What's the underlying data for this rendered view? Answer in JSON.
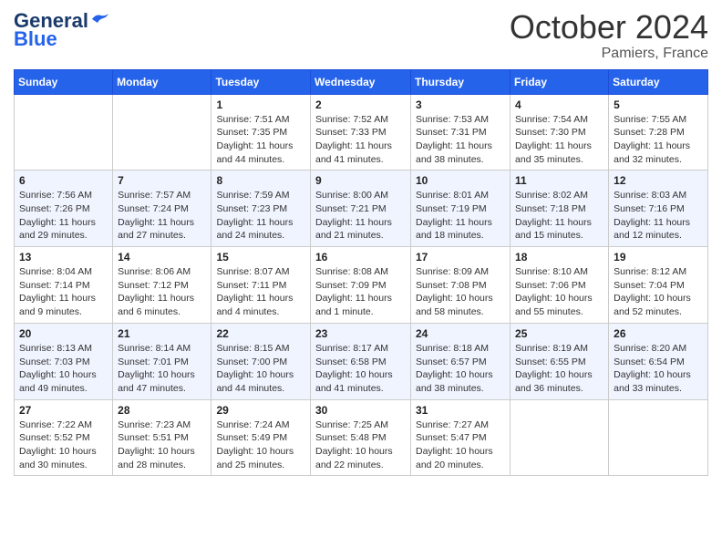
{
  "logo": {
    "text_general": "General",
    "text_blue": "Blue",
    "bird_symbol": "🐦"
  },
  "header": {
    "month_title": "October 2024",
    "location": "Pamiers, France"
  },
  "weekdays": [
    "Sunday",
    "Monday",
    "Tuesday",
    "Wednesday",
    "Thursday",
    "Friday",
    "Saturday"
  ],
  "weeks": [
    [
      {
        "day": "",
        "info": ""
      },
      {
        "day": "",
        "info": ""
      },
      {
        "day": "1",
        "info": "Sunrise: 7:51 AM\nSunset: 7:35 PM\nDaylight: 11 hours and 44 minutes."
      },
      {
        "day": "2",
        "info": "Sunrise: 7:52 AM\nSunset: 7:33 PM\nDaylight: 11 hours and 41 minutes."
      },
      {
        "day": "3",
        "info": "Sunrise: 7:53 AM\nSunset: 7:31 PM\nDaylight: 11 hours and 38 minutes."
      },
      {
        "day": "4",
        "info": "Sunrise: 7:54 AM\nSunset: 7:30 PM\nDaylight: 11 hours and 35 minutes."
      },
      {
        "day": "5",
        "info": "Sunrise: 7:55 AM\nSunset: 7:28 PM\nDaylight: 11 hours and 32 minutes."
      }
    ],
    [
      {
        "day": "6",
        "info": "Sunrise: 7:56 AM\nSunset: 7:26 PM\nDaylight: 11 hours and 29 minutes."
      },
      {
        "day": "7",
        "info": "Sunrise: 7:57 AM\nSunset: 7:24 PM\nDaylight: 11 hours and 27 minutes."
      },
      {
        "day": "8",
        "info": "Sunrise: 7:59 AM\nSunset: 7:23 PM\nDaylight: 11 hours and 24 minutes."
      },
      {
        "day": "9",
        "info": "Sunrise: 8:00 AM\nSunset: 7:21 PM\nDaylight: 11 hours and 21 minutes."
      },
      {
        "day": "10",
        "info": "Sunrise: 8:01 AM\nSunset: 7:19 PM\nDaylight: 11 hours and 18 minutes."
      },
      {
        "day": "11",
        "info": "Sunrise: 8:02 AM\nSunset: 7:18 PM\nDaylight: 11 hours and 15 minutes."
      },
      {
        "day": "12",
        "info": "Sunrise: 8:03 AM\nSunset: 7:16 PM\nDaylight: 11 hours and 12 minutes."
      }
    ],
    [
      {
        "day": "13",
        "info": "Sunrise: 8:04 AM\nSunset: 7:14 PM\nDaylight: 11 hours and 9 minutes."
      },
      {
        "day": "14",
        "info": "Sunrise: 8:06 AM\nSunset: 7:12 PM\nDaylight: 11 hours and 6 minutes."
      },
      {
        "day": "15",
        "info": "Sunrise: 8:07 AM\nSunset: 7:11 PM\nDaylight: 11 hours and 4 minutes."
      },
      {
        "day": "16",
        "info": "Sunrise: 8:08 AM\nSunset: 7:09 PM\nDaylight: 11 hours and 1 minute."
      },
      {
        "day": "17",
        "info": "Sunrise: 8:09 AM\nSunset: 7:08 PM\nDaylight: 10 hours and 58 minutes."
      },
      {
        "day": "18",
        "info": "Sunrise: 8:10 AM\nSunset: 7:06 PM\nDaylight: 10 hours and 55 minutes."
      },
      {
        "day": "19",
        "info": "Sunrise: 8:12 AM\nSunset: 7:04 PM\nDaylight: 10 hours and 52 minutes."
      }
    ],
    [
      {
        "day": "20",
        "info": "Sunrise: 8:13 AM\nSunset: 7:03 PM\nDaylight: 10 hours and 49 minutes."
      },
      {
        "day": "21",
        "info": "Sunrise: 8:14 AM\nSunset: 7:01 PM\nDaylight: 10 hours and 47 minutes."
      },
      {
        "day": "22",
        "info": "Sunrise: 8:15 AM\nSunset: 7:00 PM\nDaylight: 10 hours and 44 minutes."
      },
      {
        "day": "23",
        "info": "Sunrise: 8:17 AM\nSunset: 6:58 PM\nDaylight: 10 hours and 41 minutes."
      },
      {
        "day": "24",
        "info": "Sunrise: 8:18 AM\nSunset: 6:57 PM\nDaylight: 10 hours and 38 minutes."
      },
      {
        "day": "25",
        "info": "Sunrise: 8:19 AM\nSunset: 6:55 PM\nDaylight: 10 hours and 36 minutes."
      },
      {
        "day": "26",
        "info": "Sunrise: 8:20 AM\nSunset: 6:54 PM\nDaylight: 10 hours and 33 minutes."
      }
    ],
    [
      {
        "day": "27",
        "info": "Sunrise: 7:22 AM\nSunset: 5:52 PM\nDaylight: 10 hours and 30 minutes."
      },
      {
        "day": "28",
        "info": "Sunrise: 7:23 AM\nSunset: 5:51 PM\nDaylight: 10 hours and 28 minutes."
      },
      {
        "day": "29",
        "info": "Sunrise: 7:24 AM\nSunset: 5:49 PM\nDaylight: 10 hours and 25 minutes."
      },
      {
        "day": "30",
        "info": "Sunrise: 7:25 AM\nSunset: 5:48 PM\nDaylight: 10 hours and 22 minutes."
      },
      {
        "day": "31",
        "info": "Sunrise: 7:27 AM\nSunset: 5:47 PM\nDaylight: 10 hours and 20 minutes."
      },
      {
        "day": "",
        "info": ""
      },
      {
        "day": "",
        "info": ""
      }
    ]
  ]
}
